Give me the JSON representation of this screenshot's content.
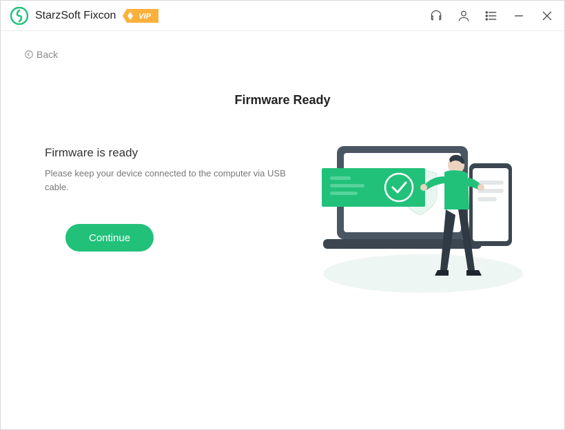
{
  "app": {
    "title": "StarzSoft Fixcon",
    "vip_label": "VIP"
  },
  "nav": {
    "back_label": "Back"
  },
  "main": {
    "heading": "Firmware Ready",
    "subheading": "Firmware is ready",
    "description": "Please keep your device connected to the computer via USB cable.",
    "continue_label": "Continue"
  },
  "colors": {
    "accent": "#22c17a",
    "accent_dark": "#1fa968",
    "vip_bg": "#fbb03b"
  }
}
